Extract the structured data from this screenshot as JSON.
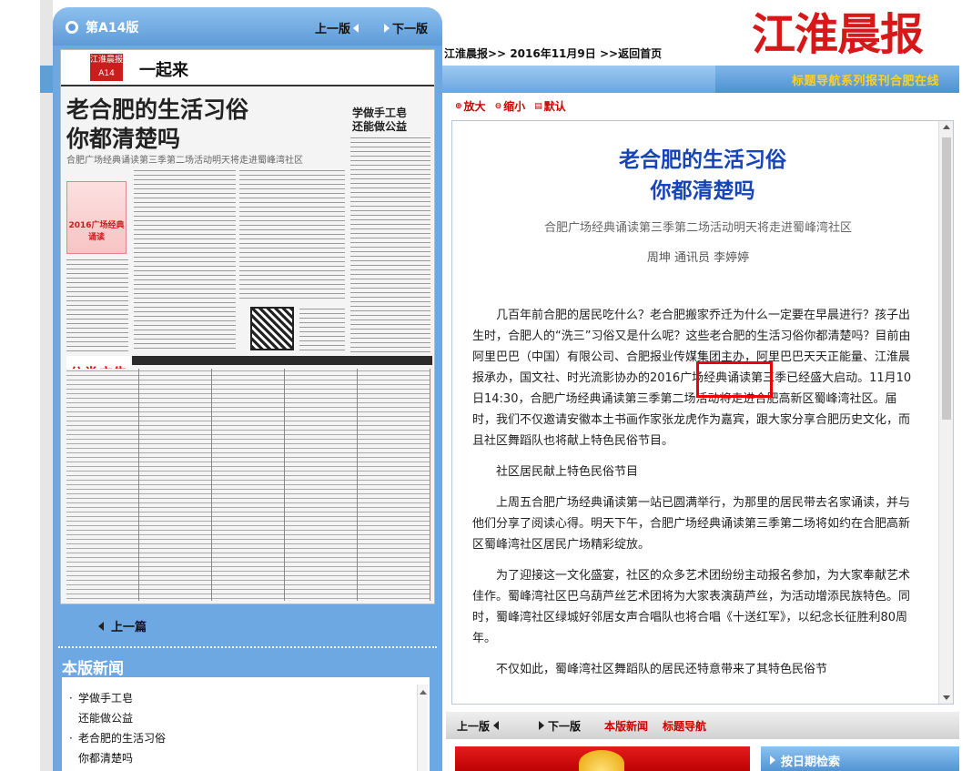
{
  "left_panel": {
    "edition": "第A14版",
    "prev_page": "上一版",
    "next_page": "下一版",
    "prev_article": "上一篇",
    "news_section_title": "本版新闻",
    "news_items": [
      {
        "line1": "学做手工皂",
        "line2": "还能做公益"
      },
      {
        "line1": "老合肥的生活习俗",
        "line2": "你都清楚吗"
      }
    ],
    "thumbnail": {
      "badge": "江淮晨报 A14",
      "section": "一起来",
      "headline_1": "老合肥的生活习俗",
      "headline_2": "你都清楚吗",
      "subhead": "合肥广场经典诵读第三季第二场活动明天将走进蜀峰湾社区",
      "side_headline_1": "学做手工皂",
      "side_headline_2": "还能做公益",
      "promo": "2016广场经典诵读",
      "ad_logo": "分类广告"
    }
  },
  "header": {
    "logo": "江淮晨报",
    "breadcrumb_site": "江淮晨报>>",
    "breadcrumb_date": "2016年11月9日",
    "breadcrumb_home": ">>返回首页",
    "top_links": [
      "标题导航",
      "系列报刊",
      "合肥在线"
    ]
  },
  "zoom": {
    "enlarge": "放大",
    "shrink": "缩小",
    "default": "默认"
  },
  "article": {
    "title_1": "老合肥的生活习俗",
    "title_2": "你都清楚吗",
    "subtitle": "合肥广场经典诵读第三季第二场活动明天将走进蜀峰湾社区",
    "author": "周坤  通讯员  李婷婷",
    "paragraphs": [
      "几百年前合肥的居民吃什么？老合肥搬家乔迁为什么一定要在早晨进行？孩子出生时，合肥人的“洗三”习俗又是什么呢？这些老合肥的生活习俗你都清楚吗？目前由阿里巴巴（中国）有限公司、合肥报业传媒集团主办，阿里巴巴天天正能量、江淮晨报承办，国文社、时光流影协办的2016广场经典诵读第三季已经盛大启动。11月10日14:30，合肥广场经典诵读第三季第二场活动将走进合肥高新区蜀峰湾社区。届时，我们不仅邀请安徽本土书画作家张龙虎作为嘉宾，跟大家分享合肥历史文化，而且社区舞蹈队也将献上特色民俗节目。",
      "社区居民献上特色民俗节目",
      "上周五合肥广场经典诵读第一站已圆满举行，为那里的居民带去名家诵读，并与他们分享了阅读心得。明天下午，合肥广场经典诵读第三季第二场将如约在合肥高新区蜀峰湾社区居民广场精彩绽放。",
      "为了迎接这一文化盛宴，社区的众多艺术团纷纷主动报名参加，为大家奉献艺术佳作。蜀峰湾社区巴乌葫芦丝艺术团将为大家表演葫芦丝，为活动增添民族特色。同时，蜀峰湾社区绿城好邻居女声合唱队也将合唱《十送红军》，以纪念长征胜利80周年。",
      "不仅如此，蜀峰湾社区舞蹈队的居民还特意带来了其特色民俗节"
    ]
  },
  "bottom_nav": {
    "prev_page": "上一版",
    "next_page": "下一版",
    "page_news": "本版新闻",
    "title_nav": "标题导航"
  },
  "date_search": "按日期检索",
  "colors": {
    "panel_blue": "#6ea8e2",
    "title_blue": "#1744b6",
    "accent_red": "#c00000",
    "highlight_red": "#e00000",
    "link_yellow": "#ffd21e"
  }
}
